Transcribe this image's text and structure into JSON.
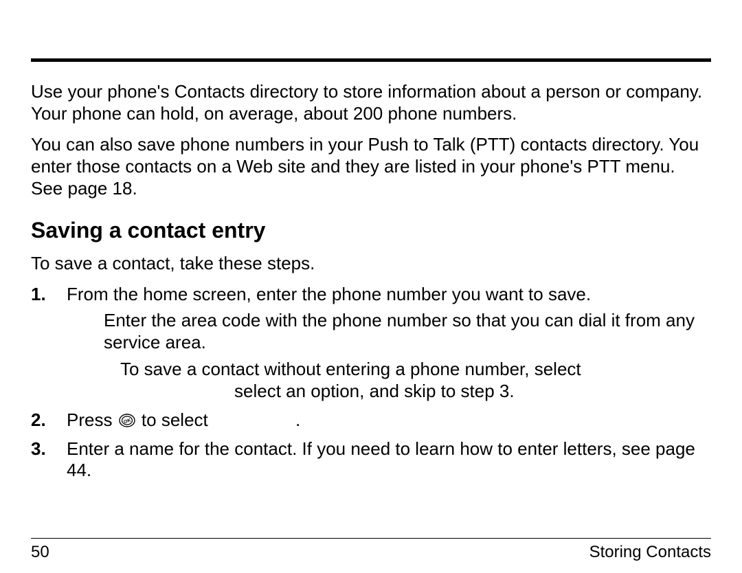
{
  "intro": {
    "p1": "Use your phone's Contacts directory to store information about a person or company. Your phone can hold, on average, about 200 phone numbers.",
    "p2": "You can also save phone numbers in your Push to Talk (PTT) contacts directory. You enter those contacts on a Web site and they are listed in your phone's PTT menu. See page 18."
  },
  "heading": "Saving a contact entry",
  "lead": "To save a contact, take these steps.",
  "steps": {
    "s1_marker": "1.",
    "s1_text": "From the home screen, enter the phone number you want to save.",
    "s1_sub": "Enter the area code with the phone number so that you can dial it from any service area.",
    "s1_sub2_line1": "To save a contact without entering a phone number, select",
    "s1_sub2_line2": "select an option, and skip to step 3.",
    "s2_marker": "2.",
    "s2_before": "Press ",
    "s2_after": " to select",
    "s2_tail": ".",
    "s3_marker": "3.",
    "s3_text": "Enter a name for the contact. If you need to learn how to enter letters, see page 44."
  },
  "footer": {
    "page": "50",
    "section": "Storing Contacts"
  }
}
